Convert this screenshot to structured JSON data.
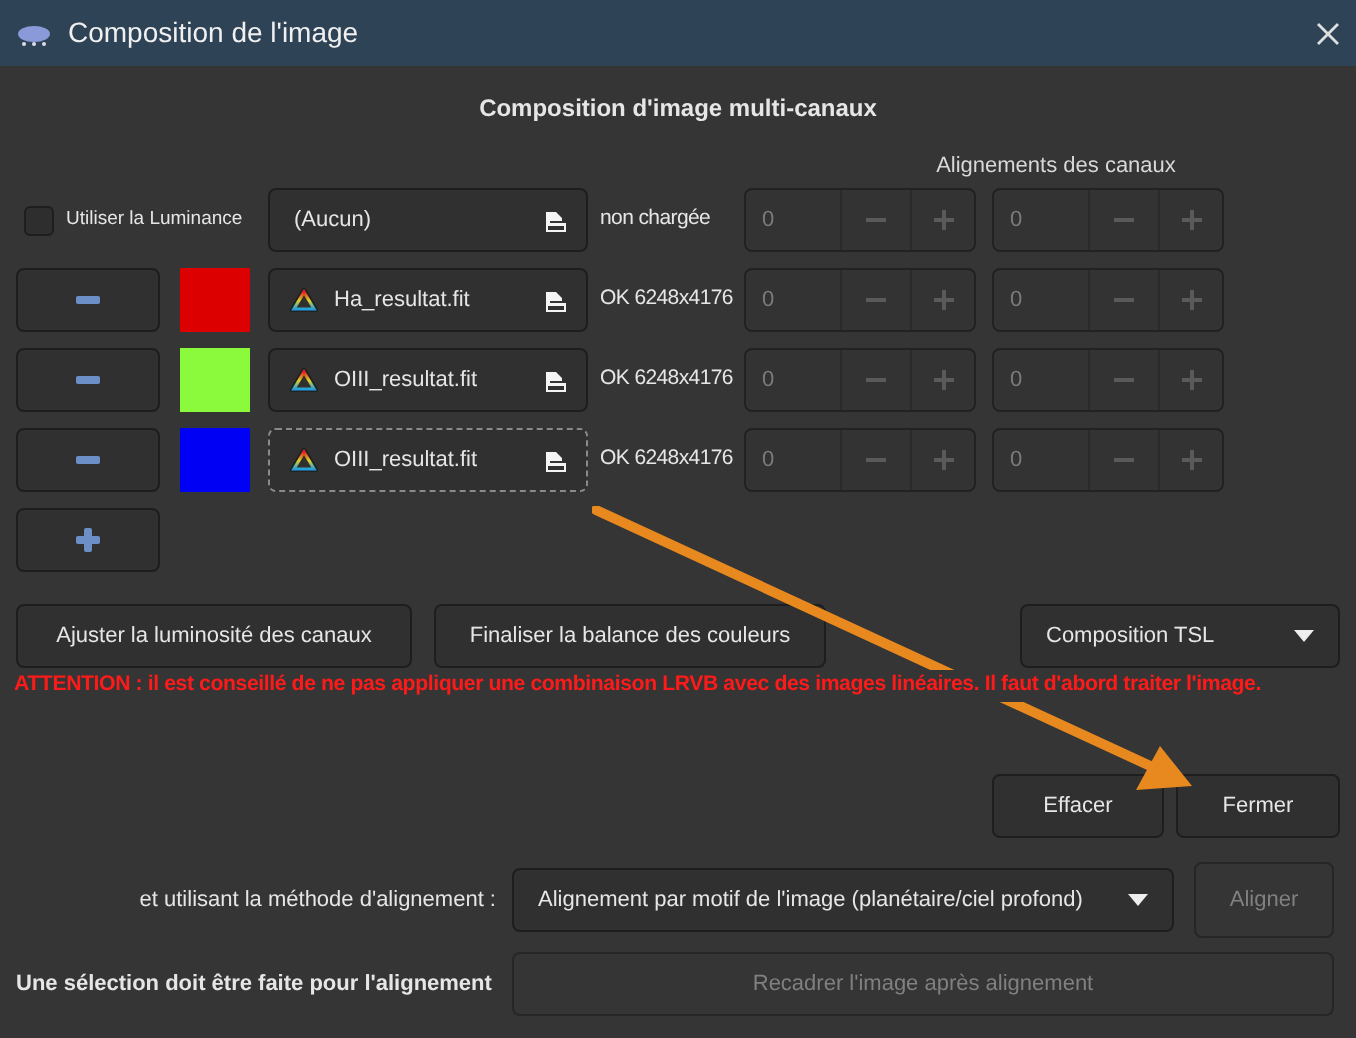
{
  "window": {
    "title": "Composition de l'image"
  },
  "heading": "Composition d'image multi-canaux",
  "alignment_header": "Alignements des canaux",
  "luminance": {
    "label": "Utiliser la Luminance",
    "checked": false,
    "file": "(Aucun)",
    "status": "non chargée",
    "focused": false,
    "offsets": [
      {
        "value": "0",
        "disabled": true
      },
      {
        "value": "0",
        "disabled": true
      }
    ]
  },
  "channels": [
    {
      "color": "#dd0000",
      "file": "Ha_resultat.fit",
      "status": "OK 6248x4176",
      "focused": false,
      "offsets": [
        {
          "value": "0",
          "disabled": true
        },
        {
          "value": "0",
          "disabled": true
        }
      ]
    },
    {
      "color": "#8cfa3c",
      "file": "OIII_resultat.fit",
      "status": "OK 6248x4176",
      "focused": false,
      "offsets": [
        {
          "value": "0",
          "disabled": true
        },
        {
          "value": "0",
          "disabled": true
        }
      ]
    },
    {
      "color": "#0000f5",
      "file": "OIII_resultat.fit",
      "status": "OK 6248x4176",
      "focused": true,
      "offsets": [
        {
          "value": "0",
          "disabled": true
        },
        {
          "value": "0",
          "disabled": true
        }
      ]
    }
  ],
  "adjust_button": "Ajuster la luminosité des canaux",
  "balance_button": "Finaliser la balance des couleurs",
  "mode_dropdown": "Composition TSL",
  "warning": "ATTENTION : il est conseillé de ne pas appliquer une combinaison LRVB avec des images linéaires. Il faut d'abord traiter l'image.",
  "clear_button": "Effacer",
  "close_button": "Fermer",
  "alignment_method": {
    "label": "et utilisant la méthode d'alignement :",
    "value": "Alignement par motif de l'image (planétaire/ciel profond)"
  },
  "align_button": {
    "label": "Aligner",
    "disabled": true
  },
  "selection_note": "Une sélection doit être faite pour l'alignement",
  "crop_button": {
    "label": "Recadrer l'image après alignement",
    "disabled": true
  }
}
